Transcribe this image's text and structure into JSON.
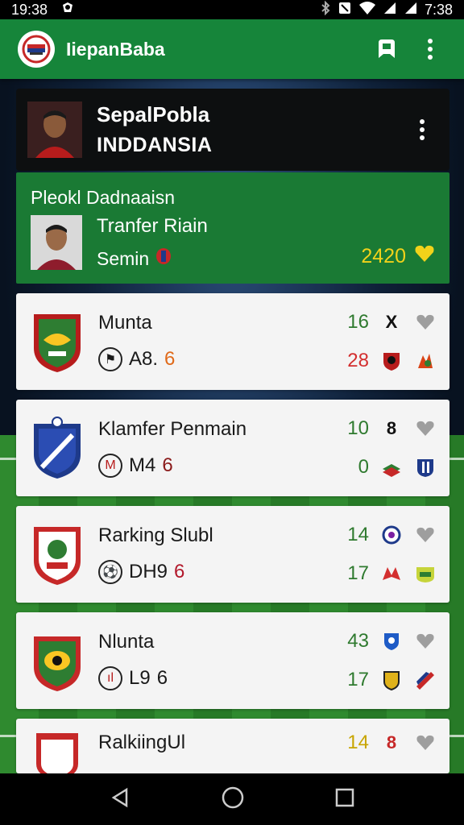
{
  "status": {
    "time_left": "19:38",
    "time_right": "7:38"
  },
  "app": {
    "title": "IiepanBaba"
  },
  "header": {
    "title": "SepalPobla",
    "subtitle": "INDDANSIA"
  },
  "featured": {
    "label": "Pleokl Dadnaaisn",
    "title": "Tranfer Riain",
    "subtitle": "Semin",
    "value": "2420"
  },
  "rows": [
    {
      "title": "Munta",
      "sub_text": "A8.",
      "sub_num": "6",
      "sub_num_color": "#e06a1a",
      "n1": "16",
      "n1_color": "#2f7a2f",
      "n2": "28",
      "n2_color": "#d32f2f",
      "mark": "X"
    },
    {
      "title": "Klamfer Penmain",
      "sub_text": "M4",
      "sub_num": "6",
      "sub_num_color": "#8a1a1a",
      "n1": "10",
      "n1_color": "#2f7a2f",
      "n2": "0",
      "n2_color": "#2f7a2f",
      "mark": "8"
    },
    {
      "title": "Rarking Slubl",
      "sub_text": "DH9",
      "sub_num": "6",
      "sub_num_color": "#b2182b",
      "n1": "14",
      "n1_color": "#2f7a2f",
      "n2": "17",
      "n2_color": "#2f7a2f",
      "mark": ""
    },
    {
      "title": "Nlunta",
      "sub_text": "L9",
      "sub_num": "6",
      "sub_num_color": "#1a1a1a",
      "n1": "43",
      "n1_color": "#2f7a2f",
      "n2": "17",
      "n2_color": "#2f7a2f",
      "mark": ""
    },
    {
      "title": "RalkiingUl",
      "sub_text": "",
      "sub_num": "",
      "sub_num_color": "#1a1a1a",
      "n1": "14",
      "n1_color": "#c8a500",
      "n2": "",
      "n2_color": "#2f7a2f",
      "mark": "8"
    }
  ],
  "colors": {
    "accent": "#16853a",
    "featured": "#1a7a34",
    "gold": "#f1d21a"
  }
}
